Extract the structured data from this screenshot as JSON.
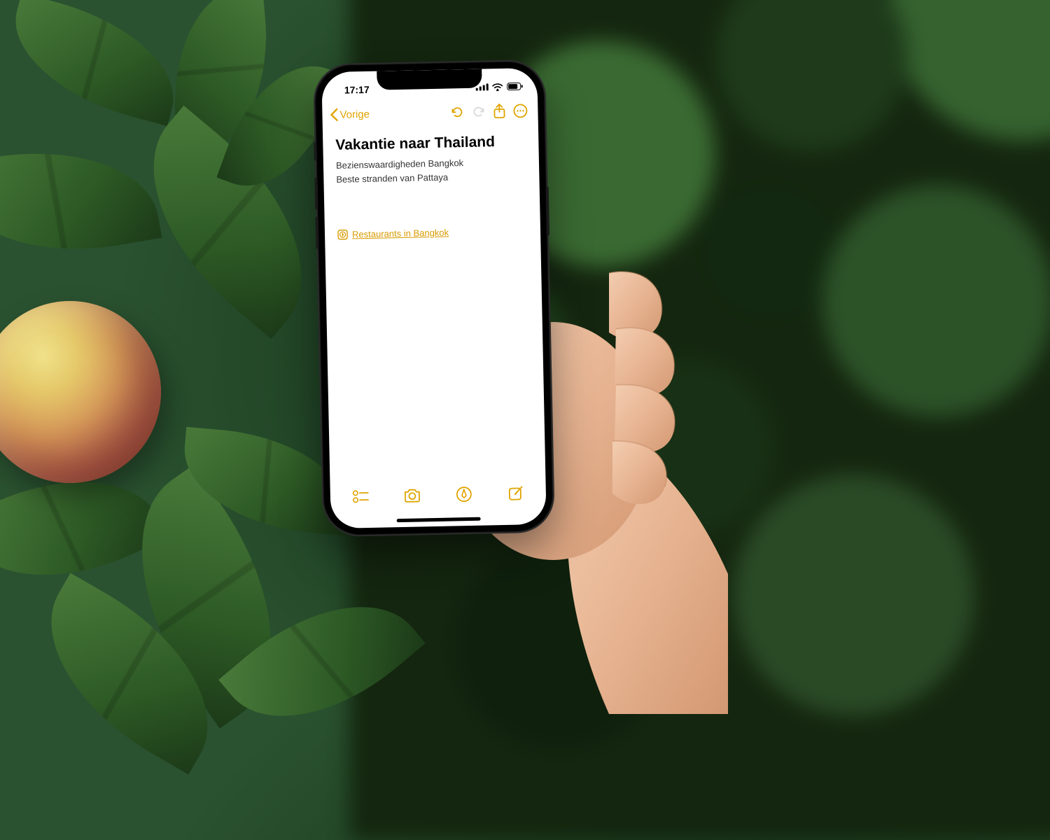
{
  "status": {
    "time": "17:17"
  },
  "nav": {
    "back_label": "Vorige"
  },
  "note": {
    "title": "Vakantie naar Thailand",
    "lines": [
      "Bezienswaardigheden Bangkok",
      "Beste stranden van Pattaya"
    ],
    "link": {
      "text": "Restaurants in Bangkok"
    }
  },
  "colors": {
    "accent": "#e0a400"
  }
}
